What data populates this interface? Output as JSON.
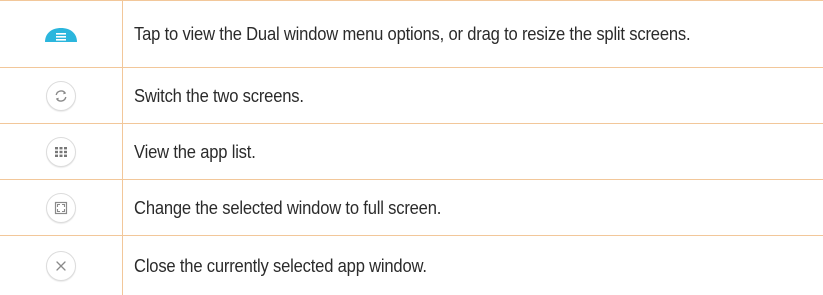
{
  "rows": [
    {
      "icon": "dual-window-handle-icon",
      "text": "Tap to view the Dual window menu options, or drag to resize the split screens."
    },
    {
      "icon": "switch-screens-icon",
      "text": "Switch the two screens."
    },
    {
      "icon": "app-list-icon",
      "text": "View the app list."
    },
    {
      "icon": "full-screen-icon",
      "text": "Change the selected window to full screen."
    },
    {
      "icon": "close-icon",
      "text": "Close the currently selected app window."
    }
  ],
  "colors": {
    "border": "#f2c79a",
    "handle": "#2bb6dd",
    "icon_gray": "#8a8a8a"
  }
}
